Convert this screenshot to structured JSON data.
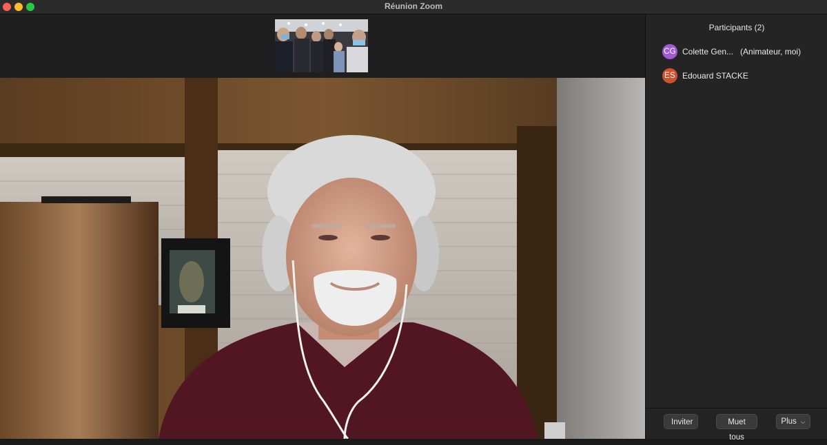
{
  "window": {
    "title": "Réunion Zoom"
  },
  "participants_panel": {
    "title": "Participants (2)",
    "participants": [
      {
        "initials": "CG",
        "name": "Colette Gen...",
        "role": "(Animateur, moi)",
        "avatar_color": "#a25ad1"
      },
      {
        "initials": "ES",
        "name": "Edouard STACKE",
        "role": "",
        "avatar_color": "#d0512f"
      }
    ],
    "buttons": {
      "invite": "Inviter",
      "mute_all": "Muet tous",
      "more": "Plus"
    }
  }
}
